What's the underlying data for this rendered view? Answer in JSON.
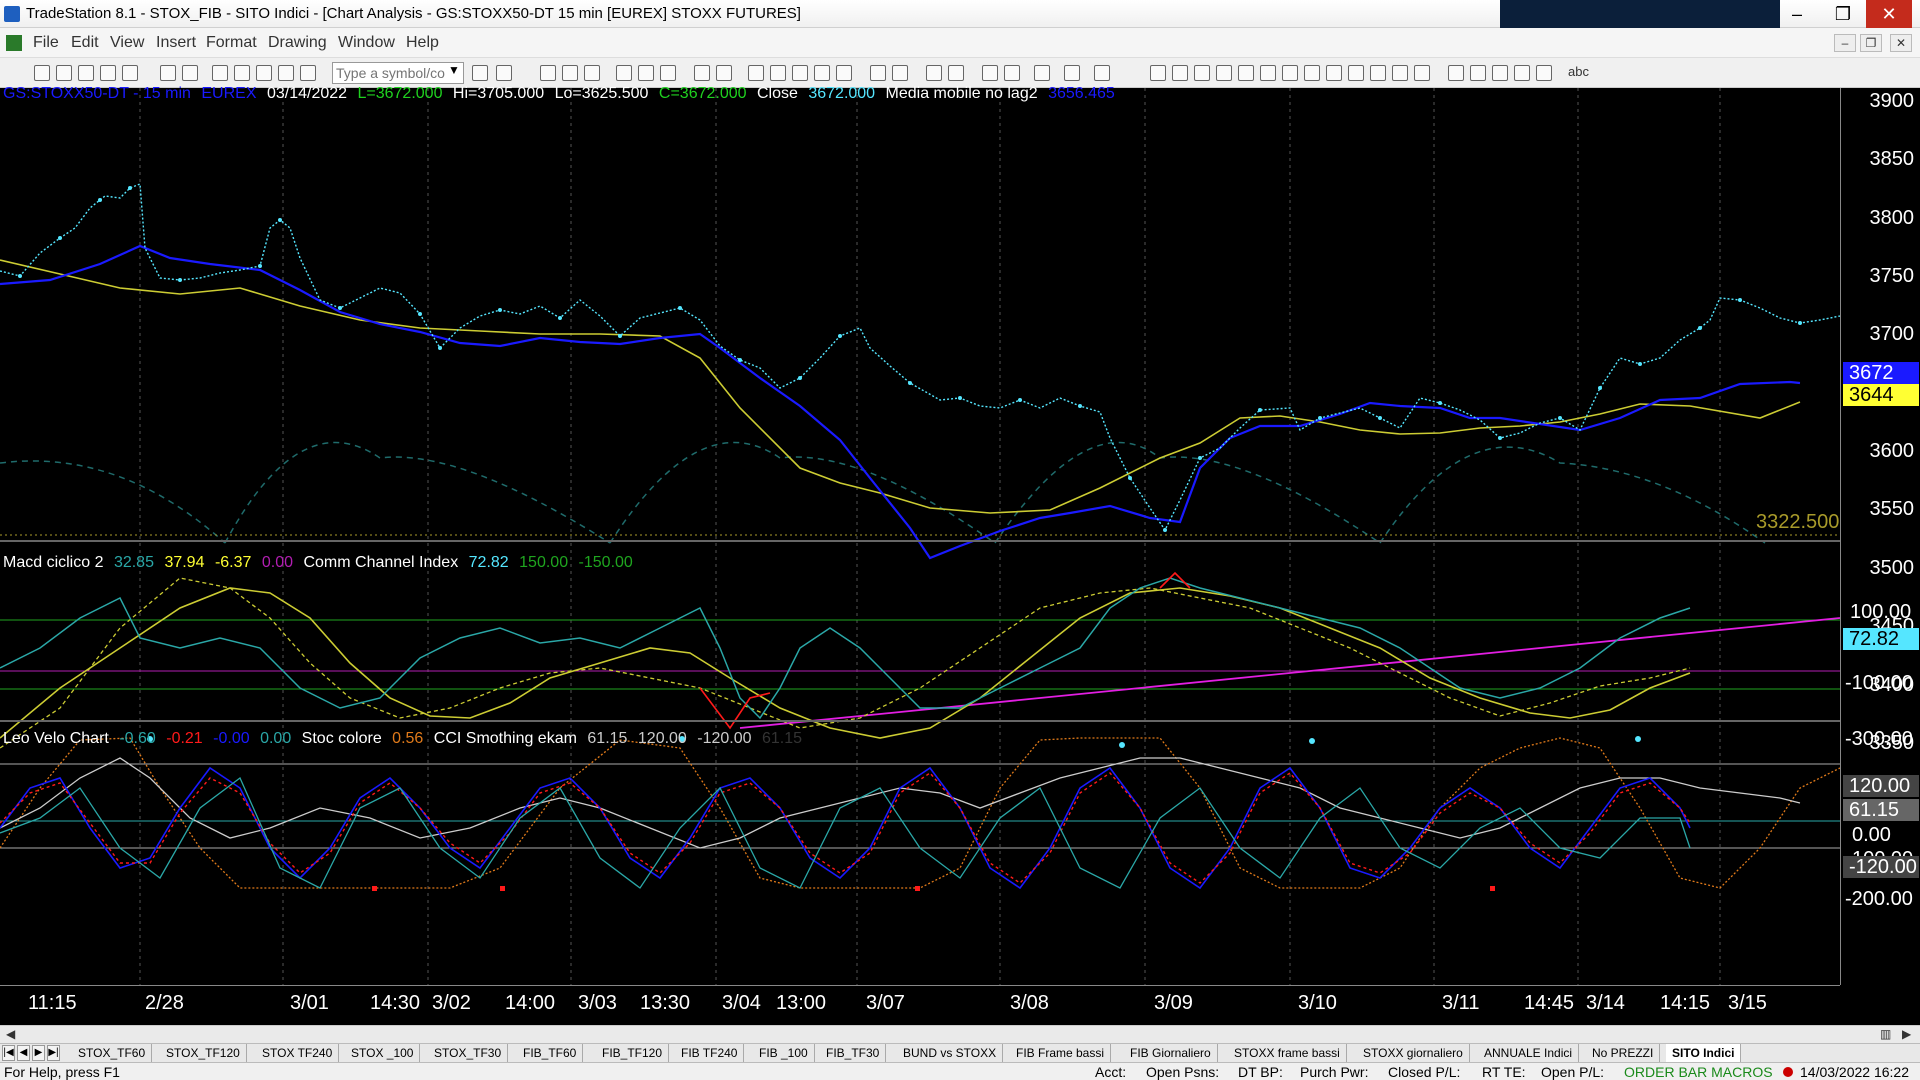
{
  "window": {
    "title": "TradeStation 8.1 - STOX_FIB - SITO Indici - [Chart Analysis - GS:STOXX50-DT  15 min  [EUREX] STOXX FUTURES]",
    "minimize": "–",
    "maximize": "❐",
    "close": "✕"
  },
  "menu": {
    "items": [
      "File",
      "Edit",
      "View",
      "Insert",
      "Format",
      "Drawing",
      "Window",
      "Help"
    ],
    "mdi_min": "–",
    "mdi_restore": "❐",
    "mdi_close": "✕"
  },
  "toolbar": {
    "symbol_placeholder": "Type a symbol/co",
    "dropdown_arrow": "▼",
    "text_tool": "abc"
  },
  "price_pane": {
    "legend": {
      "symbol": "GS:STOXX50-DT - 15 min",
      "exchange": "EUREX",
      "date": "03/14/2022",
      "last": "L=3672.000",
      "high": "Hi=3705.000",
      "low": "Lo=3625.500",
      "close": "C=3672.000",
      "close_label": "Close",
      "close_value": "3672.000",
      "ma_name": "Media mobile no lag2",
      "ma_value": "3656.465"
    },
    "axis_labels": [
      "3900",
      "3850",
      "3800",
      "3750",
      "3700",
      "3650",
      "3600",
      "3550",
      "3500",
      "3450",
      "3400",
      "3350"
    ],
    "tag_last": "3672",
    "tag_ma": "3644",
    "support_label": "3322.500"
  },
  "macd_pane": {
    "legend": {
      "name": "Macd ciclico 2",
      "v1": "32.85",
      "v2": "37.94",
      "v3": "-6.37",
      "v4": "0.00",
      "cci_name": "Comm Channel Index",
      "cci_value": "72.82",
      "upper": "150.00",
      "lower": "-150.00"
    },
    "axis_labels": [
      "-100.00",
      "-300.00"
    ],
    "axis_partial": "100.00",
    "tag_cci": "72.82"
  },
  "velo_pane": {
    "legend": {
      "name": "Leo Velo Chart",
      "v1": "-0.60",
      "v2": "-0.21",
      "v3": "-0.00",
      "v4": "0.00",
      "stoc_name": "Stoc colore",
      "stoc_value": "0.56",
      "cci_name": "CCI Smothing ekam",
      "cci_value": "61.15",
      "upper": "120.00",
      "lower": "-120.00",
      "extra": "61.15"
    },
    "axis_labels": [
      "0.00",
      "-200.00"
    ],
    "axis_partial": "100.00",
    "tag_upper": "120.00",
    "tag_cci": "61.15",
    "tag_lower": "-120.00"
  },
  "time_axis": [
    "11:15",
    "2/28",
    "3/01",
    "14:30",
    "3/02",
    "14:00",
    "3/03",
    "13:30",
    "3/04",
    "13:00",
    "3/07",
    "3/08",
    "3/09",
    "3/10",
    "3/11",
    "14:45",
    "3/14",
    "14:15",
    "3/15"
  ],
  "tabs": [
    "STOX_TF60",
    "STOX_TF120",
    "STOX TF240",
    "STOX _100",
    "STOX_TF30",
    "FIB_TF60",
    "FIB_TF120",
    "FIB TF240",
    "FIB _100",
    "FIB_TF30",
    "BUND vs STOXX",
    "FIB Frame bassi",
    "FIB Giornaliero",
    "STOXX frame bassi",
    "STOXX giornaliero",
    "ANNUALE Indici",
    "No PREZZI",
    "SITO Indici"
  ],
  "tab_nav": [
    "|◀",
    "◀",
    "▶",
    "▶|"
  ],
  "status": {
    "help": "For Help, press F1",
    "acct": "Acct:",
    "open_psns": "Open Psns:",
    "dt_bp": "DT BP:",
    "purch_pwr": "Purch Pwr:",
    "closed_pl": "Closed P/L:",
    "rt_te": "RT TE:",
    "open_pl": "Open P/L:",
    "macros": "ORDER BAR  MACROS",
    "datetime": "14/03/2022 16:22"
  },
  "colors": {
    "price": "#55e6ff",
    "ma_fast": "#1a1aff",
    "ma_slow": "#cccc33",
    "cycle_dashed": "#1f6b6b",
    "magenta": "#e21ee2",
    "red": "#ff1a1a",
    "green": "#1fa51f",
    "teal": "#2aa7a7",
    "gray": "#aaaaaa",
    "orange": "#e07a1a"
  },
  "chart_data": {
    "type": "line",
    "symbol": "GS:STOXX50-DT",
    "interval": "15 min",
    "price_axis_range": [
      3310,
      3930
    ],
    "series": [
      {
        "name": "Close",
        "x_labels": [
          "11:15",
          "2/28",
          "3/01",
          "14:30",
          "3/02",
          "14:00",
          "3/03",
          "13:30",
          "3/04",
          "13:00",
          "3/07",
          "3/08",
          "3/09",
          "3/10",
          "3/11",
          "14:45",
          "3/14",
          "14:15"
        ],
        "values": [
          3760,
          3885,
          3780,
          3820,
          3720,
          3760,
          3700,
          3730,
          3750,
          3740,
          3560,
          3530,
          3480,
          3330,
          3420,
          3500,
          3460,
          3480,
          3440,
          3600,
          3610,
          3700,
          3610,
          3580,
          3600,
          3670,
          3620,
          3690,
          3660,
          3672
        ]
      },
      {
        "name": "Media mobile no lag2",
        "values": [
          3750,
          3810,
          3780,
          3790,
          3760,
          3720,
          3740,
          3730,
          3720,
          3690,
          3600,
          3520,
          3430,
          3440,
          3450,
          3460,
          3470,
          3550,
          3590,
          3620,
          3630,
          3620,
          3610,
          3600,
          3640,
          3656
        ]
      },
      {
        "name": "Slow average",
        "values": [
          3800,
          3780,
          3760,
          3740,
          3730,
          3725,
          3720,
          3720,
          3650,
          3560,
          3510,
          3480,
          3470,
          3460,
          3480,
          3530,
          3580,
          3600,
          3605,
          3600,
          3600,
          3610,
          3630,
          3644
        ]
      }
    ],
    "support_level": 3322.5
  }
}
